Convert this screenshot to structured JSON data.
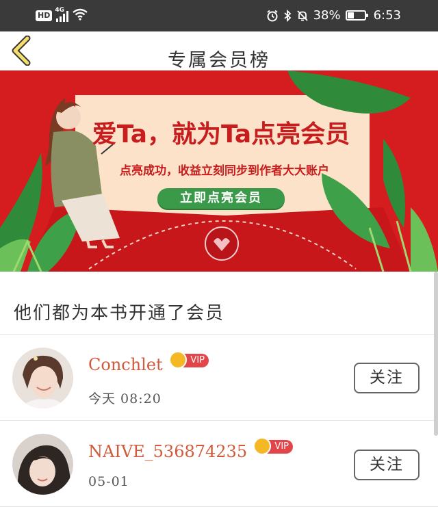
{
  "status_bar": {
    "hd": "HD",
    "network": "4G",
    "battery_text": "38%",
    "battery_level": 0.38,
    "time": "6:53",
    "icons": [
      "wifi-icon",
      "alarm-icon",
      "bluetooth-icon",
      "mute-icon",
      "battery-icon"
    ]
  },
  "nav": {
    "title": "专属会员榜",
    "back_icon": "chevron-left-icon"
  },
  "banner": {
    "title": "爱Ta，就为Ta点亮会员",
    "subtitle": "点亮成功，收益立刻同步到作者大大账户",
    "button_label": "立即点亮会员"
  },
  "section": {
    "header": "他们都为本书开通了会员"
  },
  "members": [
    {
      "name": "Conchlet",
      "vip": "VIP",
      "time": "今天  08:20",
      "follow": "关注"
    },
    {
      "name": "NAIVE_536874235",
      "vip": "VIP",
      "time": "05-01",
      "follow": "关注"
    }
  ],
  "colors": {
    "status_bg": "#3a3a3a",
    "banner_red": "#d51c1f",
    "name_color": "#d05a3a",
    "vip_red": "#e2454a",
    "crown_gold": "#f3b824",
    "button_green": "#3b9a4a"
  }
}
